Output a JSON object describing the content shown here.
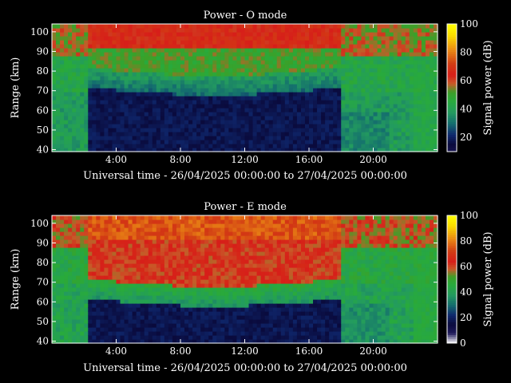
{
  "chart_data": [
    {
      "type": "heatmap",
      "title": "Power - O mode",
      "xlabel": "Universal time - 26/04/2025 00:00:00 to 27/04/2025 00:00:00",
      "ylabel": "Range (km)",
      "xlim": [
        0,
        24
      ],
      "ylim": [
        39,
        104
      ],
      "xticks": [
        4,
        8,
        12,
        16,
        20
      ],
      "xtick_labels": [
        "4:00",
        "8:00",
        "12:00",
        "16:00",
        "20:00"
      ],
      "yticks": [
        40,
        50,
        60,
        70,
        80,
        90,
        100
      ],
      "ytick_labels": [
        "40",
        "50",
        "60",
        "70",
        "80",
        "90",
        "100"
      ],
      "colorbar": {
        "label": "Signal power (dB)",
        "range": [
          10,
          100
        ],
        "ticks": [
          20,
          40,
          60,
          80,
          100
        ],
        "tick_labels": [
          "20",
          "40",
          "60",
          "80",
          "100"
        ]
      },
      "mode": "O",
      "regimes": {
        "quiet_start_utc": 2.3,
        "quiet_end_utc": 18.0,
        "low_layer_top_km": 68,
        "low_layer_power_db": 18,
        "mid_layer_power_db": 38,
        "upper_power_db": 55,
        "top_power_db": 66,
        "edge_power_db": 40
      }
    },
    {
      "type": "heatmap",
      "title": "Power - E mode",
      "xlabel": "Universal time - 26/04/2025 00:00:00 to 27/04/2025 00:00:00",
      "ylabel": "Range (km)",
      "xlim": [
        0,
        24
      ],
      "ylim": [
        39,
        104
      ],
      "xticks": [
        4,
        8,
        12,
        16,
        20
      ],
      "xtick_labels": [
        "4:00",
        "8:00",
        "12:00",
        "16:00",
        "20:00"
      ],
      "yticks": [
        40,
        50,
        60,
        70,
        80,
        90,
        100
      ],
      "ytick_labels": [
        "40",
        "50",
        "60",
        "70",
        "80",
        "90",
        "100"
      ],
      "colorbar": {
        "label": "Signal power (dB)",
        "range": [
          0,
          100
        ],
        "ticks": [
          0,
          20,
          40,
          60,
          80,
          100
        ],
        "tick_labels": [
          "0",
          "20",
          "40",
          "60",
          "80",
          "100"
        ]
      },
      "mode": "E",
      "regimes": {
        "quiet_start_utc": 2.3,
        "quiet_end_utc": 18.0,
        "low_layer_top_km": 58,
        "low_layer_power_db": 18,
        "mid_layer_power_db": 45,
        "upper_power_db": 66,
        "top_power_db": 75,
        "edge_power_db": 42
      }
    }
  ]
}
